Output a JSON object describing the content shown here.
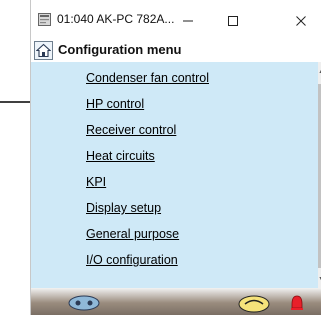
{
  "window": {
    "title": "01:040 AK-PC 782A...",
    "controls": {
      "minimize": "—",
      "maximize": "☐",
      "close": "✕"
    }
  },
  "header": {
    "title": "Configuration menu",
    "icon": "home-icon"
  },
  "menu": {
    "items": [
      {
        "label": "Condenser fan control"
      },
      {
        "label": "HP control"
      },
      {
        "label": "Receiver control"
      },
      {
        "label": "Heat circuits"
      },
      {
        "label": "KPI"
      },
      {
        "label": "Display setup"
      },
      {
        "label": "General purpose"
      },
      {
        "label": "I/O configuration"
      }
    ]
  },
  "colors": {
    "content_bg": "#cfe9f7",
    "statusbar": "#9a8c7e",
    "alarm": "#e8202a"
  }
}
